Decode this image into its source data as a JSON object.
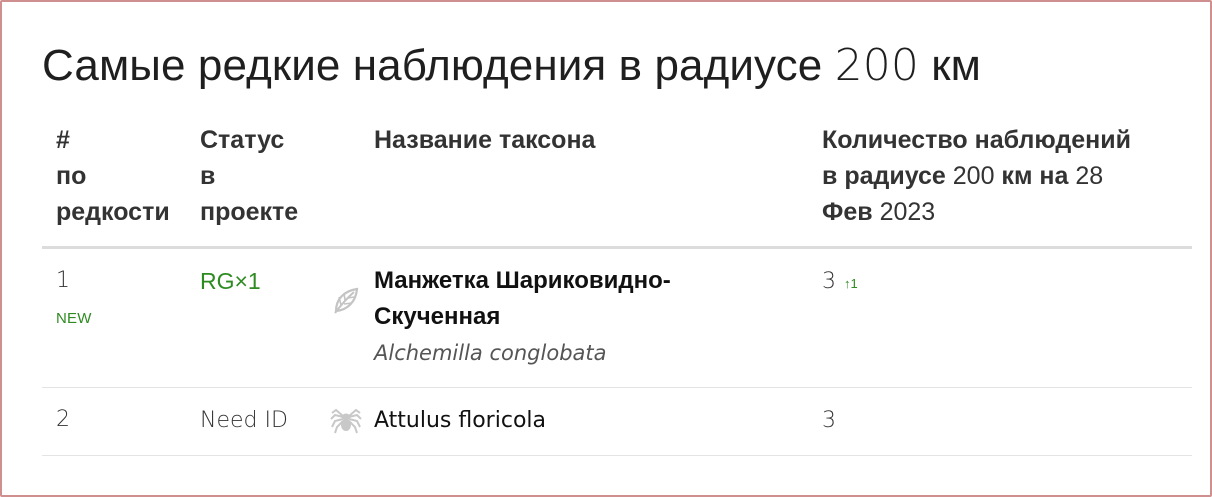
{
  "page": {
    "title_text": "Самые редкие наблюдения в радиусе ",
    "title_num": "200",
    "title_unit": " км"
  },
  "table": {
    "headers": {
      "rank": [
        "#",
        "по",
        "редкости"
      ],
      "status": [
        "Статус",
        "в",
        "проекте"
      ],
      "taxon": "Название таксона",
      "count_a": "Количество наблюдений",
      "count_b": "в радиусе ",
      "count_num1": "200",
      "count_c": " км на ",
      "count_num2": "28",
      "count_d": "Фев",
      "count_num3": " 2023"
    },
    "rows": [
      {
        "rank": "1",
        "badge": "NEW",
        "status": "RG×1",
        "icon": "plant-leaf-icon",
        "common_name": "Манжетка Шариковидно-Скученная",
        "scientific_name": "Alchemilla conglobata",
        "count": "3",
        "count_delta": "↑1"
      },
      {
        "rank": "2",
        "status": "Need ID",
        "icon": "spider-icon",
        "name": "Attulus floricola",
        "count": "3"
      }
    ]
  },
  "colors": {
    "accent_green": "#2e8b22",
    "frame_border": "#d08f8f"
  }
}
